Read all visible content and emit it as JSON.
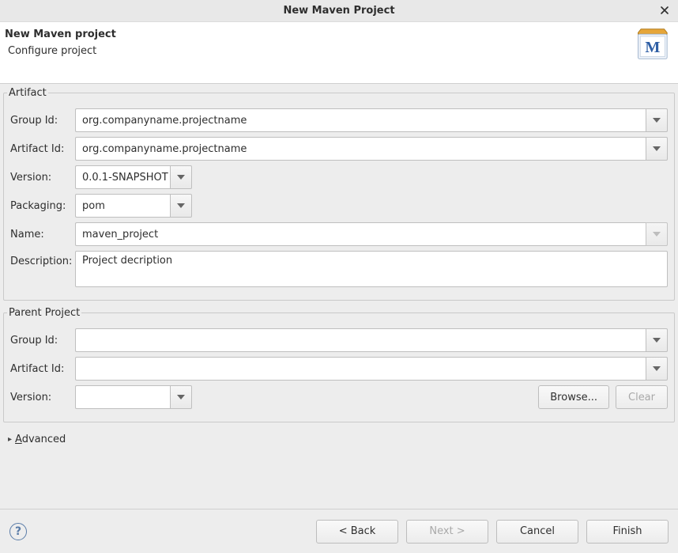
{
  "window": {
    "title": "New Maven Project"
  },
  "banner": {
    "heading": "New Maven project",
    "subheading": "Configure project"
  },
  "artifact": {
    "legend": "Artifact",
    "labels": {
      "groupId": "Group Id:",
      "artifactId": "Artifact Id:",
      "version": "Version:",
      "packaging": "Packaging:",
      "name": "Name:",
      "description": "Description:"
    },
    "values": {
      "groupId": "org.companyname.projectname",
      "artifactId": "org.companyname.projectname",
      "version": "0.0.1-SNAPSHOT",
      "packaging": "pom",
      "name": "maven_project",
      "description": "Project decription"
    }
  },
  "parent": {
    "legend": "Parent Project",
    "labels": {
      "groupId": "Group Id:",
      "artifactId": "Artifact Id:",
      "version": "Version:"
    },
    "values": {
      "groupId": "",
      "artifactId": "",
      "version": ""
    },
    "buttons": {
      "browse": "Browse...",
      "clear": "Clear"
    }
  },
  "advanced": {
    "label_prefix": "A",
    "label_rest": "dvanced"
  },
  "footer": {
    "back": "< Back",
    "next": "Next >",
    "cancel": "Cancel",
    "finish": "Finish"
  }
}
